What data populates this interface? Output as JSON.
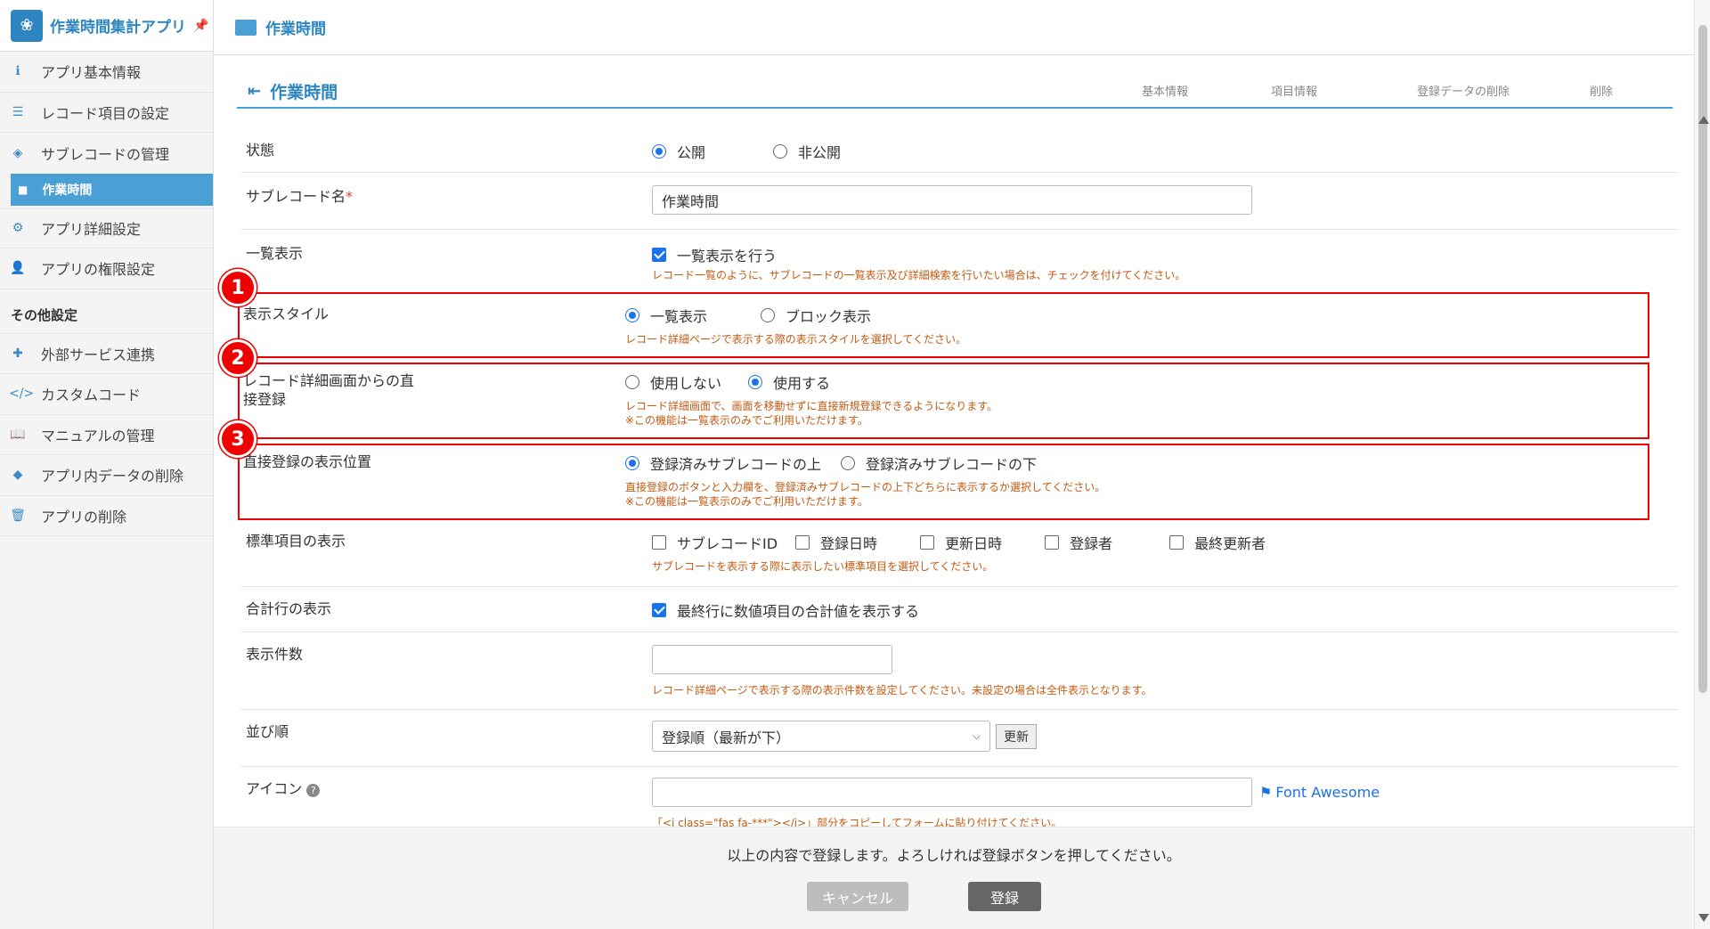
{
  "app": {
    "name": "作業時間集計アプリ",
    "pin_icon": "pin-icon"
  },
  "sidebar": {
    "items": [
      {
        "label": "アプリ基本情報",
        "icon": "info-icon"
      },
      {
        "label": "レコード項目の設定",
        "icon": "list-icon"
      },
      {
        "label": "サブレコードの管理",
        "icon": "layers-icon"
      }
    ],
    "sub_item": {
      "label": "作業時間",
      "icon": "folder-icon"
    },
    "items2": [
      {
        "label": "アプリ詳細設定",
        "icon": "gear-icon"
      },
      {
        "label": "アプリの権限設定",
        "icon": "user-lock-icon"
      }
    ],
    "other_heading": "その他設定",
    "items3": [
      {
        "label": "外部サービス連携",
        "icon": "puzzle-icon"
      },
      {
        "label": "カスタムコード",
        "icon": "code-icon"
      },
      {
        "label": "マニュアルの管理",
        "icon": "book-icon"
      },
      {
        "label": "アプリ内データの削除",
        "icon": "eraser-icon"
      },
      {
        "label": "アプリの削除",
        "icon": "trash-icon"
      }
    ]
  },
  "topbar": {
    "title": "作業時間"
  },
  "page": {
    "title": "作業時間",
    "tabs": [
      "基本情報",
      "項目情報",
      "登録データの削除",
      "削除"
    ]
  },
  "form": {
    "status": {
      "label": "状態",
      "options": [
        "公開",
        "非公開"
      ],
      "selected": "公開"
    },
    "name": {
      "label": "サブレコード名",
      "required_mark": "*",
      "value": "作業時間"
    },
    "list_display": {
      "label": "一覧表示",
      "checkbox": "一覧表示を行う",
      "checked": true,
      "hint": "レコード一覧のように、サブレコードの一覧表示及び詳細検索を行いたい場合は、チェックを付けてください。"
    },
    "display_style": {
      "label": "表示スタイル",
      "options": [
        "一覧表示",
        "ブロック表示"
      ],
      "selected": "一覧表示",
      "hint": "レコード詳細ページで表示する際の表示スタイルを選択してください。"
    },
    "direct_register": {
      "label": "レコード詳細画面からの直接登録",
      "options": [
        "使用しない",
        "使用する"
      ],
      "selected": "使用する",
      "hint1": "レコード詳細画面で、画面を移動せずに直接新規登録できるようになります。",
      "hint2": "※この機能は一覧表示のみでご利用いただけます。"
    },
    "direct_position": {
      "label": "直接登録の表示位置",
      "options": [
        "登録済みサブレコードの上",
        "登録済みサブレコードの下"
      ],
      "selected": "登録済みサブレコードの上",
      "hint1": "直接登録のボタンと入力欄を、登録済みサブレコードの上下どちらに表示するか選択してください。",
      "hint2": "※この機能は一覧表示のみでご利用いただけます。"
    },
    "standard_items": {
      "label": "標準項目の表示",
      "options": [
        "サブレコードID",
        "登録日時",
        "更新日時",
        "登録者",
        "最終更新者"
      ],
      "hint": "サブレコードを表示する際に表示したい標準項目を選択してください。"
    },
    "total_row": {
      "label": "合計行の表示",
      "checkbox": "最終行に数値項目の合計値を表示する",
      "checked": true
    },
    "count": {
      "label": "表示件数",
      "value": "",
      "hint": "レコード詳細ページで表示する際の表示件数を設定してください。未設定の場合は全件表示となります。"
    },
    "sort": {
      "label": "並び順",
      "value": "登録順（最新が下）",
      "update_button": "更新"
    },
    "icon": {
      "label": "アイコン",
      "value": "",
      "link": "Font Awesome",
      "hint": "「<i class=\"fas fa-***\"></i>」部分をコピーしてフォームに貼り付けてください。"
    }
  },
  "badges": [
    "1",
    "2",
    "3"
  ],
  "footer": {
    "message": "以上の内容で登録します。よろしければ登録ボタンを押してください。",
    "cancel": "キャンセル",
    "submit": "登録"
  },
  "colors": {
    "accent": "#2e86c1",
    "highlight": "#e00000",
    "hint": "#c55a11"
  }
}
